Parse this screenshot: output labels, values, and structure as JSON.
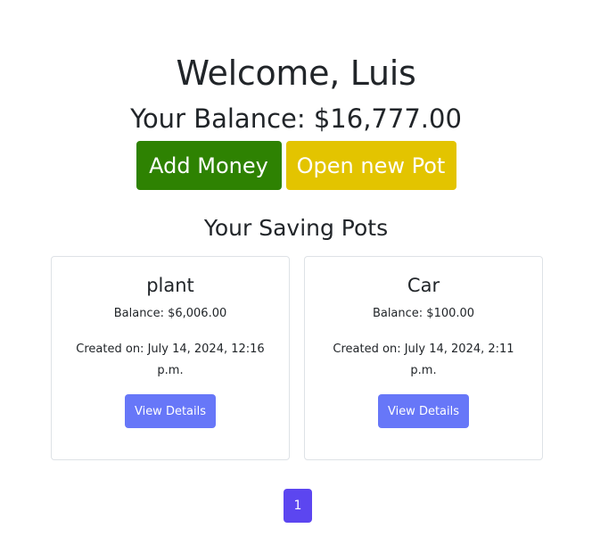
{
  "header": {
    "welcome": "Welcome, Luis",
    "balance": "Your Balance: $16,777.00"
  },
  "actions": {
    "add_money": "Add Money",
    "open_pot": "Open new Pot"
  },
  "pots": {
    "title": "Your Saving Pots",
    "items": [
      {
        "name": "plant",
        "balance": "Balance: $6,006.00",
        "created": "Created on: July 14, 2024, 12:16 p.m.",
        "button": "View Details"
      },
      {
        "name": "Car",
        "balance": "Balance: $100.00",
        "created": "Created on: July 14, 2024, 2:11 p.m.",
        "button": "View Details"
      }
    ]
  },
  "pagination": {
    "current_page": "1"
  },
  "colors": {
    "add_money": "#2e8202",
    "open_pot": "#e3c400",
    "view_details": "#6777f8",
    "pagination_active": "#5c46f0"
  }
}
